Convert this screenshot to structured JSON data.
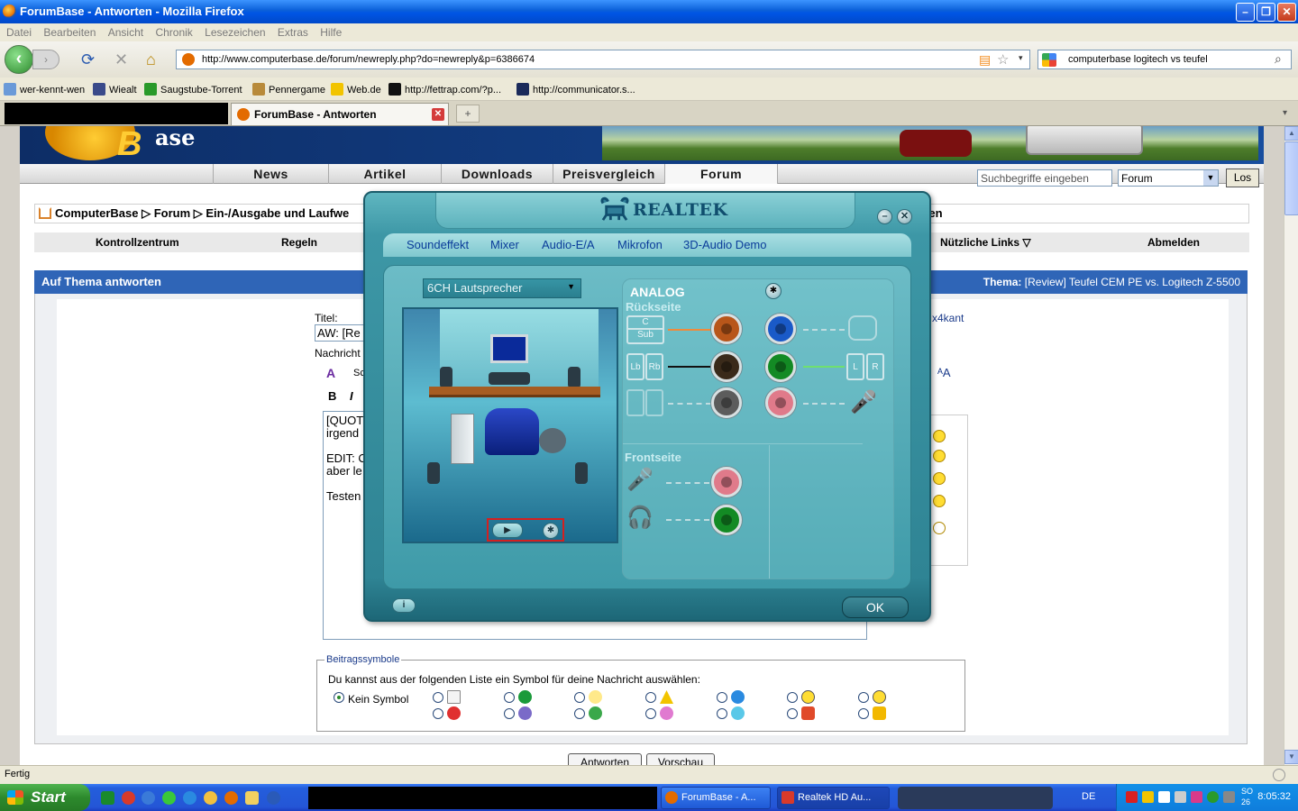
{
  "window": {
    "title": "ForumBase - Antworten - Mozilla Firefox",
    "minimize": "–",
    "restore": "❐",
    "close": "✕"
  },
  "menu": [
    "Datei",
    "Bearbeiten",
    "Ansicht",
    "Chronik",
    "Lesezeichen",
    "Extras",
    "Hilfe"
  ],
  "navbar": {
    "back": "‹",
    "forward": "›",
    "url": "http://www.computerbase.de/forum/newreply.php?do=newreply&p=6386674",
    "search_value": "computerbase logitech vs teufel"
  },
  "bookmarks": [
    "wer-kennt-wen",
    "Wiealt",
    "Saugstube-Torrent",
    "Pennergame",
    "Web.de",
    "http://fettrap.com/?p...",
    "http://communicator.s..."
  ],
  "tabs": {
    "active_title": "ForumBase - Antworten",
    "close": "✕",
    "new_tab": "+",
    "list": "▾"
  },
  "site": {
    "logo_text": "ase",
    "nav": [
      "News",
      "Artikel",
      "Downloads",
      "Preisvergleich",
      "Forum"
    ],
    "search_placeholder": "Suchbegriffe eingeben",
    "search_scope": "Forum",
    "search_go": "Los",
    "breadcrumb": "ComputerBase ▷ Forum ▷ Ein-/Ausgabe und Laufwe",
    "breadcrumb_right": "rten",
    "ctrl": {
      "kontrollzentrum": "Kontrollzentrum",
      "regeln": "Regeln",
      "nuetzliche": "Nützliche Links ▽",
      "abmelden": "Abmelden"
    },
    "panel_title": "Auf Thema antworten",
    "thread_label": "Thema:",
    "thread_title": "[Review] Teufel CEM PE vs. Logitech Z-5500",
    "title_label": "Titel:",
    "title_value": "AW: [Re",
    "message_label": "Nachricht",
    "editor_bold": "B",
    "editor_italic": "I",
    "editor_font": "Sc",
    "message_lines": [
      "[QUOT",
      "irgend",
      "",
      "EDIT: C",
      "aber le",
      "",
      "Testen"
    ],
    "user_link": "x4kant",
    "symbols_legend": "Beitragssymbole",
    "symbols_hint": "Du kannst aus der folgenden Liste ein Symbol für deine Nachricht auswählen:",
    "no_symbol": "Kein Symbol",
    "submit": "Antworten",
    "preview": "Vorschau"
  },
  "status": "Fertig",
  "taskbar": {
    "start": "Start",
    "task_firefox": "ForumBase - A...",
    "task_realtek": "Realtek HD Au...",
    "lang": "DE",
    "day": "SO",
    "date": "26",
    "time": "8:05:32"
  },
  "realtek": {
    "logo": "REALTEK",
    "tabs": [
      "Soundeffekt",
      "Mixer",
      "Audio-E/A",
      "Mikrofon",
      "3D-Audio Demo"
    ],
    "speaker_config": "6CH Lautsprecher",
    "analog": "ANALOG",
    "rear": "Rückseite",
    "front": "Frontseite",
    "icon_center": "C",
    "icon_sub": "Sub",
    "icon_lb": "Lb",
    "icon_rb": "Rb",
    "icon_l": "L",
    "icon_r": "R",
    "play": "▶",
    "info": "i",
    "ok": "OK",
    "jack_colors": {
      "orange": "#b8561a",
      "black": "#3a2a1a",
      "gray": "#5c5c5c",
      "blue": "#1a5ac8",
      "green": "#138a24",
      "pink": "#e07a8a"
    }
  }
}
